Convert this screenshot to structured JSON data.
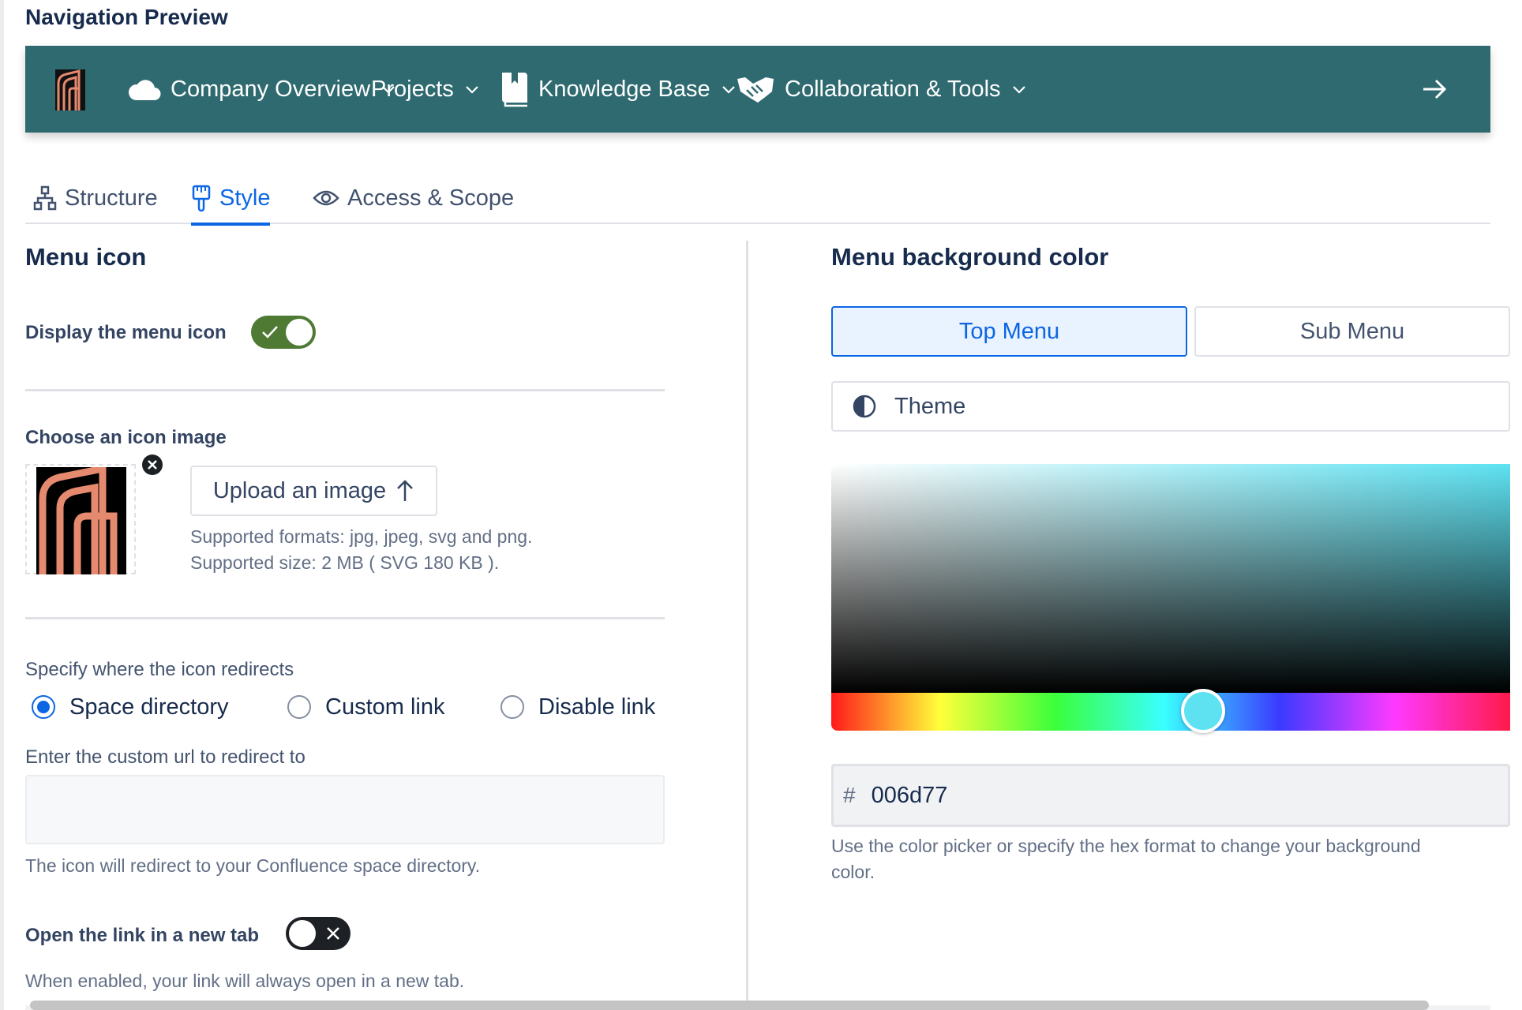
{
  "preview_title": "Navigation Preview",
  "nav": {
    "bg_color": "#2e6a70",
    "items": [
      {
        "label": "Company Overview",
        "icon": "cloud-icon"
      },
      {
        "label": "Projects",
        "icon": ""
      },
      {
        "label": "Knowledge Base",
        "icon": "book-icon"
      },
      {
        "label": "Collaboration & Tools",
        "icon": "handshake-icon"
      }
    ]
  },
  "tabs": [
    {
      "label": "Structure",
      "icon": "hierarchy-icon"
    },
    {
      "label": "Style",
      "icon": "paintbrush-icon",
      "active": true
    },
    {
      "label": "Access & Scope",
      "icon": "eye-icon"
    }
  ],
  "menu_icon": {
    "title": "Menu icon",
    "display_label": "Display the menu icon",
    "display_enabled": true,
    "choose_label": "Choose an icon image",
    "upload_label": "Upload an image",
    "formats_help": "Supported formats: jpg, jpeg, svg and png.",
    "size_help": "Supported size: 2 MB ( SVG 180 KB ).",
    "redirect_label": "Specify where the icon redirects",
    "redirect_options": [
      "Space directory",
      "Custom link",
      "Disable link"
    ],
    "redirect_selected": "Space directory",
    "custom_url_label": "Enter the custom url to redirect to",
    "custom_url_value": "",
    "redirect_help": "The icon will redirect to your Confluence space directory.",
    "new_tab_label": "Open the link in a new tab",
    "new_tab_enabled": false,
    "new_tab_help": "When enabled, your link will always open in a new tab."
  },
  "background": {
    "title": "Menu background color",
    "segments": [
      "Top Menu",
      "Sub Menu"
    ],
    "segment_selected": "Top Menu",
    "theme_label": "Theme",
    "hex_symbol": "#",
    "hex_value": "006d77",
    "help_line1": "Use the color picker or specify the hex format to change your background",
    "help_line2": "color."
  }
}
